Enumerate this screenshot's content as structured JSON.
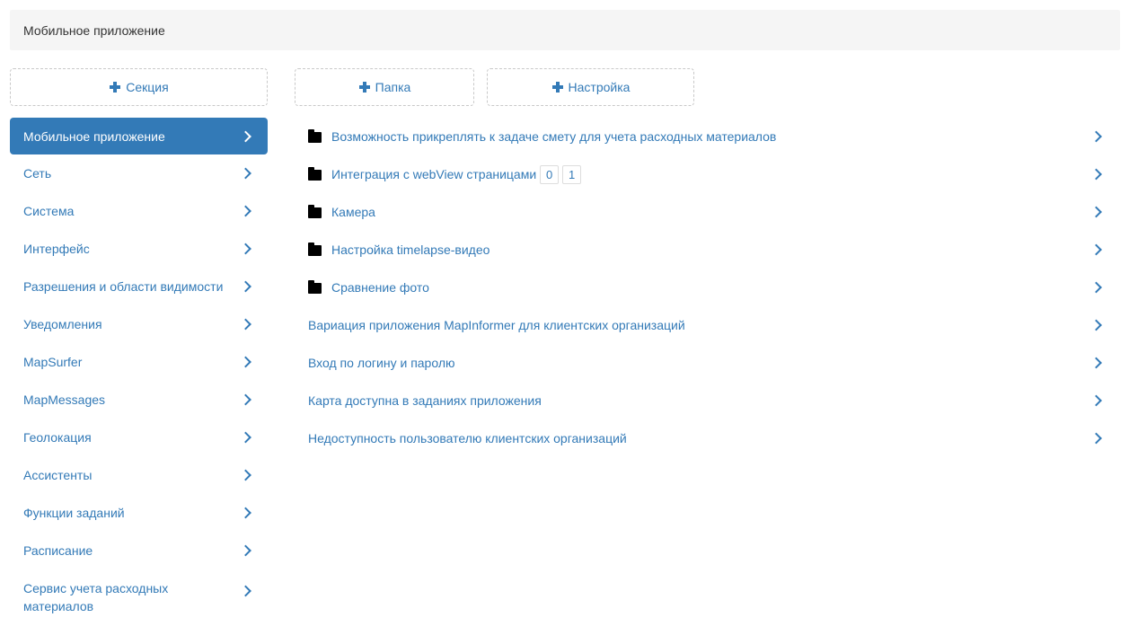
{
  "header": {
    "title": "Мобильное приложение"
  },
  "buttons": {
    "section": "Секция",
    "folder": "Папка",
    "setting": "Настройка"
  },
  "sidebar": {
    "items": [
      {
        "label": "Мобильное приложение",
        "active": true
      },
      {
        "label": "Сеть"
      },
      {
        "label": "Система"
      },
      {
        "label": "Интерфейс"
      },
      {
        "label": "Разрешения и области видимости"
      },
      {
        "label": "Уведомления"
      },
      {
        "label": "MapSurfer"
      },
      {
        "label": "MapMessages"
      },
      {
        "label": "Геолокация"
      },
      {
        "label": "Ассистенты"
      },
      {
        "label": "Функции заданий"
      },
      {
        "label": "Расписание"
      },
      {
        "label": "Сервис учета расходных материалов"
      }
    ]
  },
  "folders": [
    {
      "label": "Возможность прикреплять к задаче смету для учета расходных материалов",
      "icon": "folder-icon"
    },
    {
      "label": "Интеграция с webView страницами",
      "icon": "folder-icon",
      "badges": [
        "0",
        "1"
      ]
    },
    {
      "label": "Камера",
      "icon": "folder-icon"
    },
    {
      "label": "Настройка timelapse-видео",
      "icon": "folder-icon"
    },
    {
      "label": "Сравнение фото",
      "icon": "folder-icon"
    }
  ],
  "settings": [
    {
      "label": "Вариация приложения MapInformer для клиентских организаций"
    },
    {
      "label": "Вход по логину и паролю"
    },
    {
      "label": "Карта доступна в заданиях приложения"
    },
    {
      "label": "Недоступность пользователю клиентских организаций"
    }
  ],
  "colors": {
    "accent": "#337ab7",
    "header_bg": "#f5f5f5",
    "active_text": "#ffffff"
  }
}
